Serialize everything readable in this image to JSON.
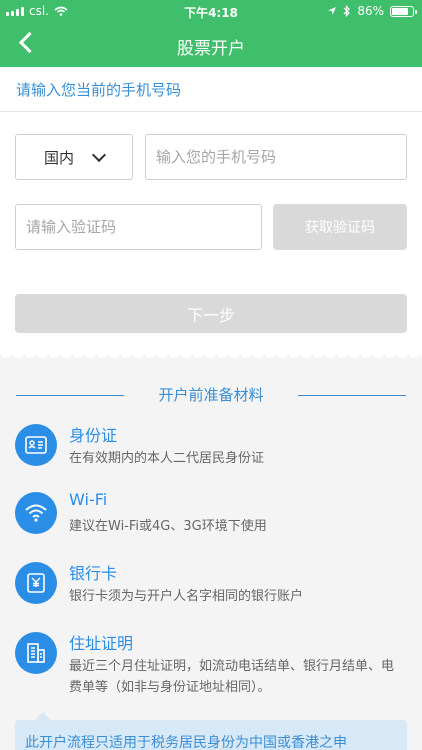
{
  "status_bar": {
    "carrier": "csl.",
    "time": "下午4:18",
    "battery": "86%",
    "battery_level": 0.86,
    "icons": [
      "signal-icon",
      "wifi-icon",
      "location-icon",
      "bluetooth-icon",
      "battery-icon"
    ]
  },
  "nav": {
    "title": "股票开户",
    "back_icon": "back-arrow-icon"
  },
  "form": {
    "hint": "请输入您当前的手机号码",
    "region_value": "国内",
    "phone_placeholder": "输入您的手机号码",
    "code_placeholder": "请输入验证码",
    "get_code_label": "获取验证码",
    "next_label": "下一步"
  },
  "materials": {
    "title": "开户前准备材料",
    "items": [
      {
        "name": "身份证",
        "desc": "在有效期内的本人二代居民身份证",
        "icon": "id-card-icon"
      },
      {
        "name": "Wi-Fi",
        "desc": "建议在Wi-Fi或4G、3G环境下使用",
        "icon": "wifi-icon"
      },
      {
        "name": "银行卡",
        "desc": "银行卡须为与开户人名字相同的银行账户",
        "icon": "bank-card-icon"
      },
      {
        "name": "住址证明",
        "desc": "最近三个月住址证明，如流动电话结单、银行月结单、电费单等（如非与身份证地址相同）。",
        "icon": "building-icon"
      }
    ]
  },
  "notice": {
    "text": "此开户流程只适用于税务居民身份为中国或香港之申"
  },
  "colors": {
    "header_green": "#3fbf6b",
    "accent_blue": "#3a8fd3",
    "icon_blue": "#2b8ee6",
    "disabled_gray": "#d9d9d9"
  }
}
